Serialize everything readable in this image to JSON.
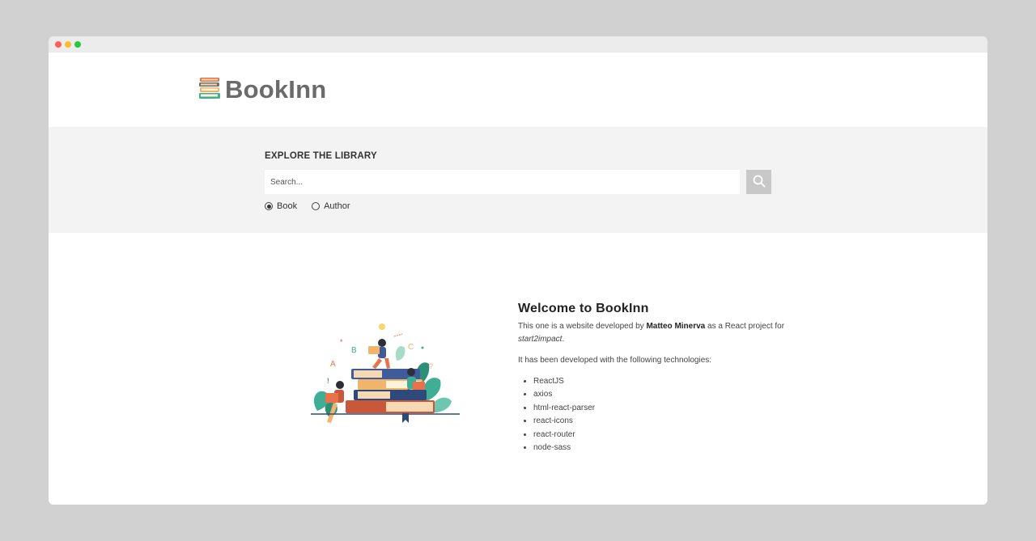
{
  "window": {
    "dots": [
      "#ff5f57",
      "#febc2e",
      "#28c840"
    ]
  },
  "header": {
    "logo_text": "BookInn",
    "logo_icon": "books-stack-icon"
  },
  "search": {
    "title": "EXPLORE THE LIBRARY",
    "placeholder": "Search...",
    "button_icon": "search-icon",
    "options": [
      {
        "label": "Book",
        "selected": true
      },
      {
        "label": "Author",
        "selected": false
      }
    ]
  },
  "welcome": {
    "heading": "Welcome to BookInn",
    "intro_pre": "This one is a website developed by ",
    "author": "Matteo Minerva",
    "intro_mid": " as a React project for ",
    "project": "start2impact",
    "intro_post": ".",
    "tech_intro": "It has been developed with the following technologies:",
    "technologies": [
      "ReactJS",
      "axios",
      "html-react-parser",
      "react-icons",
      "react-router",
      "node-sass"
    ]
  },
  "colors": {
    "accent_orange": "#e8734a",
    "accent_teal": "#3fae95",
    "accent_navy": "#2e4a7d"
  }
}
